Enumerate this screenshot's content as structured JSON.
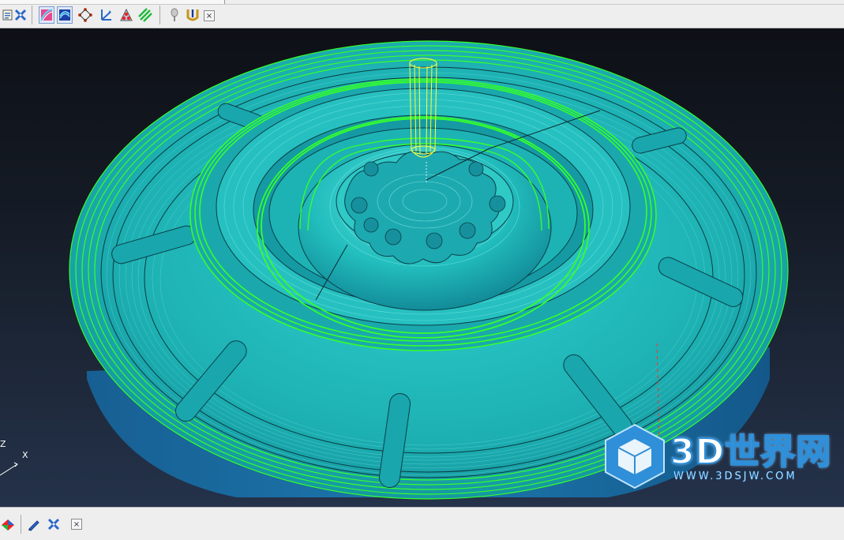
{
  "top_toolbar": {
    "buttons": [
      {
        "icon": "document-icon"
      },
      {
        "icon": "cross-tool-icon"
      },
      {
        "icon": "gradient-toolpath-icon"
      },
      {
        "icon": "swirl-toolpath-icon"
      },
      {
        "icon": "diamond-points-icon"
      },
      {
        "icon": "axis-arrows-icon"
      },
      {
        "icon": "red-dots-icon"
      },
      {
        "icon": "green-lines-icon"
      },
      {
        "icon": "probe-icon"
      },
      {
        "icon": "tool-holder-icon"
      }
    ],
    "close_label": "×"
  },
  "viewport": {
    "axis": {
      "z_label": "Z",
      "x_label": "X"
    },
    "watermark": {
      "title": "3D世界网",
      "url": "WWW.3DSJW.COM"
    }
  },
  "bottom_toolbar": {
    "buttons": [
      {
        "icon": "colored-shape-icon"
      },
      {
        "icon": "pencil-icon"
      },
      {
        "icon": "cross-tool-icon"
      }
    ],
    "close_label": "×"
  },
  "colors": {
    "part": "#1fb6b6",
    "part_side": "#1a6ea3",
    "toolpath": "#35ff2c",
    "tool": "#ffff3a",
    "background": "#1b2230"
  }
}
